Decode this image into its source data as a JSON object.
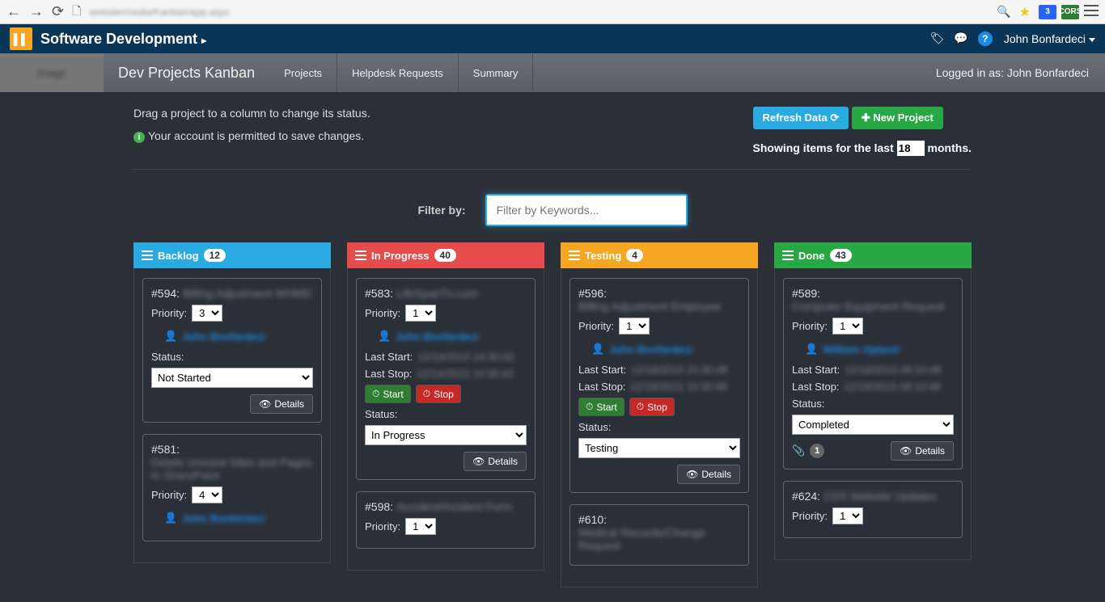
{
  "browser": {
    "url": "website/media/Kanban/app.aspx"
  },
  "header": {
    "title": "Software Development",
    "user": "John Bonfardeci"
  },
  "nav": {
    "app_name": "Dev Projects Kanban",
    "tabs": [
      "Projects",
      "Helpdesk Requests",
      "Summary"
    ],
    "logged_in": "Logged in as: John Bonfardeci"
  },
  "toprow": {
    "instruction": "Drag a project to a column to change its status.",
    "permission": "Your account is permitted to save changes.",
    "refresh": "Refresh Data",
    "new_project": "New Project",
    "showing_prefix": "Showing items for the last",
    "months_value": "18",
    "showing_suffix": "months."
  },
  "filter": {
    "label": "Filter by:",
    "placeholder": "Filter by Keywords..."
  },
  "columns": [
    {
      "name": "Backlog",
      "count": "12",
      "class": "bg-backlog"
    },
    {
      "name": "In Progress",
      "count": "40",
      "class": "bg-progress"
    },
    {
      "name": "Testing",
      "count": "4",
      "class": "bg-testing"
    },
    {
      "name": "Done",
      "count": "43",
      "class": "bg-done"
    }
  ],
  "labels": {
    "priority": "Priority:",
    "status": "Status:",
    "last_start": "Last Start:",
    "last_stop": "Last Stop:",
    "start": "Start",
    "stop": "Stop",
    "details": "Details"
  },
  "statuses": {
    "not_started": "Not Started",
    "in_progress": "In Progress",
    "testing": "Testing",
    "completed": "Completed"
  },
  "cards": {
    "backlog": [
      {
        "id": "#594:",
        "priority": "3"
      },
      {
        "id": "#581:",
        "priority": "4"
      }
    ],
    "in_progress": [
      {
        "id": "#583:",
        "priority": "1"
      },
      {
        "id": "#598:",
        "priority": "1"
      }
    ],
    "testing": [
      {
        "id": "#596:",
        "priority": "1"
      },
      {
        "id": "#610:"
      }
    ],
    "done": [
      {
        "id": "#589:",
        "priority": "1",
        "attachments": "1"
      },
      {
        "id": "#624:",
        "priority": "1"
      }
    ]
  }
}
